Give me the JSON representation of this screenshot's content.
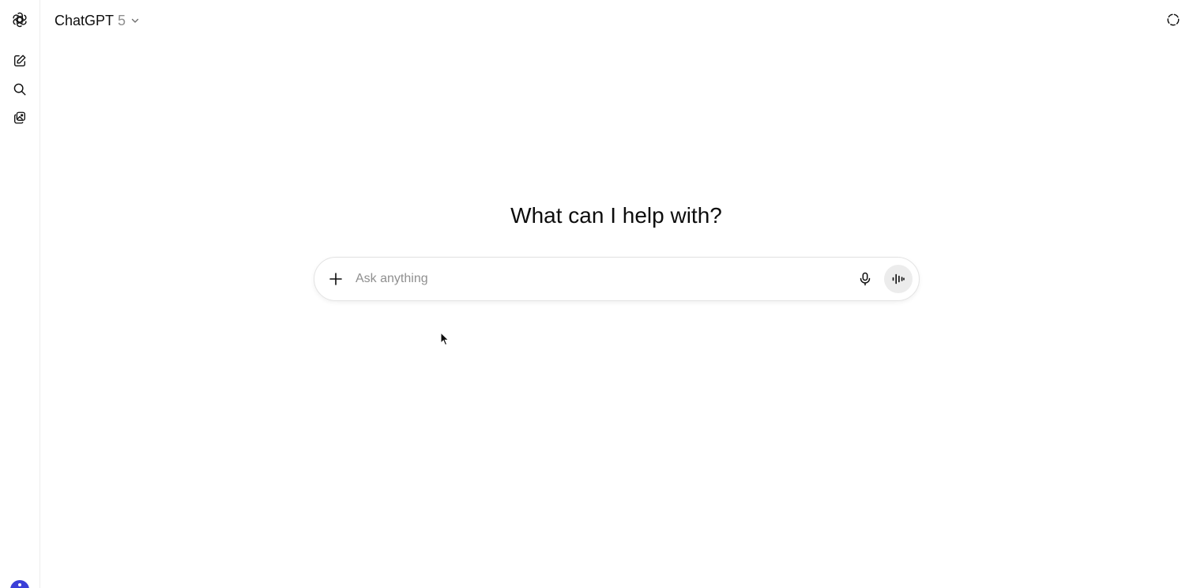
{
  "header": {
    "model_name": "ChatGPT",
    "model_version": "5"
  },
  "sidebar": {
    "items": [
      {
        "icon": "new-chat-icon"
      },
      {
        "icon": "search-icon"
      },
      {
        "icon": "library-icon"
      }
    ]
  },
  "main": {
    "headline": "What can I help with?"
  },
  "composer": {
    "placeholder": "Ask anything",
    "value": ""
  },
  "colors": {
    "text_primary": "#0d0d0d",
    "text_muted": "#8f8f8f",
    "border": "#e3e3e3",
    "voice_button_bg": "#ececec",
    "avatar": "#3b3fd8"
  }
}
